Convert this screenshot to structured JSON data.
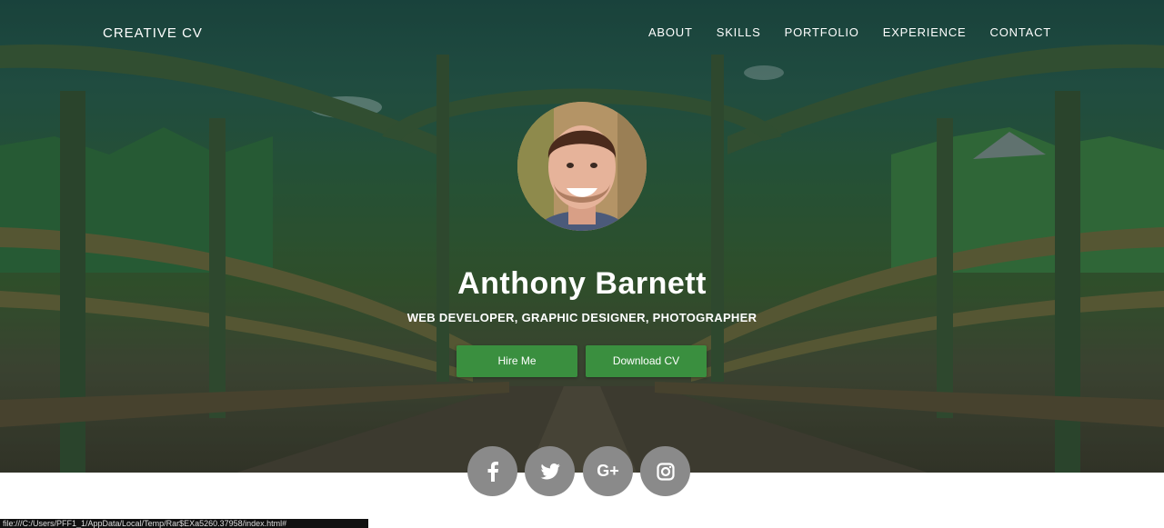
{
  "nav": {
    "brand": "CREATIVE CV",
    "links": [
      "ABOUT",
      "SKILLS",
      "PORTFOLIO",
      "EXPERIENCE",
      "CONTACT"
    ]
  },
  "hero": {
    "name": "Anthony Barnett",
    "subtitle": "WEB DEVELOPER, GRAPHIC DESIGNER, PHOTOGRAPHER",
    "buttons": {
      "hire": "Hire Me",
      "download": "Download CV"
    }
  },
  "social": {
    "google_plus_label": "G+",
    "icons": [
      "facebook-icon",
      "twitter-icon",
      "google-plus-icon",
      "instagram-icon"
    ]
  },
  "status_url": "file:///C:/Users/PFF1_1/AppData/Local/Temp/Rar$EXa5260.37958/index.html#",
  "colors": {
    "accent": "#3a8f3f",
    "social": "#8a8a8a"
  }
}
